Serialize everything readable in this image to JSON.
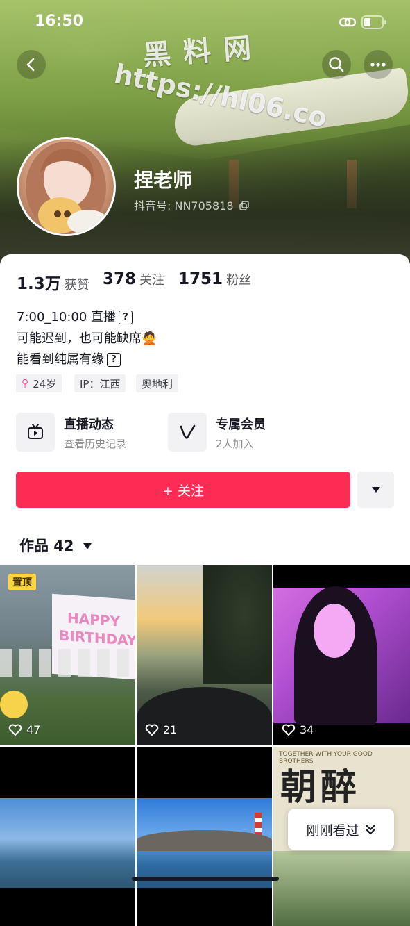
{
  "status_bar": {
    "time": "16:50"
  },
  "watermark": {
    "line1": "黑 料 网",
    "line2": "https://hl06.co"
  },
  "profile": {
    "name": "捏老师",
    "douyin_id": "抖音号: NN705818",
    "stats": [
      {
        "value": "1.3万",
        "label": "获赞"
      },
      {
        "value": "378",
        "label": "关注"
      },
      {
        "value": "1751",
        "label": "粉丝"
      }
    ],
    "bio": [
      "7:00_10:00 直播",
      "可能迟到，也可能缺席🙅",
      "能看到纯属有缘"
    ],
    "tags": [
      "24岁",
      "IP：江西",
      "奥地利"
    ]
  },
  "features": [
    {
      "title": "直播动态",
      "subtitle": "查看历史记录"
    },
    {
      "title": "专属会员",
      "subtitle": "2人加入"
    }
  ],
  "actions": {
    "follow_label": "+ 关注"
  },
  "works": {
    "tab_label": "作品 42",
    "items": [
      {
        "likes": "47",
        "pinned_label": "置顶"
      },
      {
        "likes": "21"
      },
      {
        "likes": "34"
      },
      {
        "likes": ""
      },
      {
        "likes": ""
      },
      {
        "likes": ""
      }
    ],
    "overlay_text": {
      "birthday": "HAPPY BIRTHDAY",
      "poster_top": "TOGETHER WITH YOUR GOOD BROTHERS",
      "poster_title": "朝醉"
    }
  },
  "recently_viewed": "刚刚看过",
  "colors": {
    "accent": "#fe2c55",
    "pin": "#ffd53f"
  }
}
